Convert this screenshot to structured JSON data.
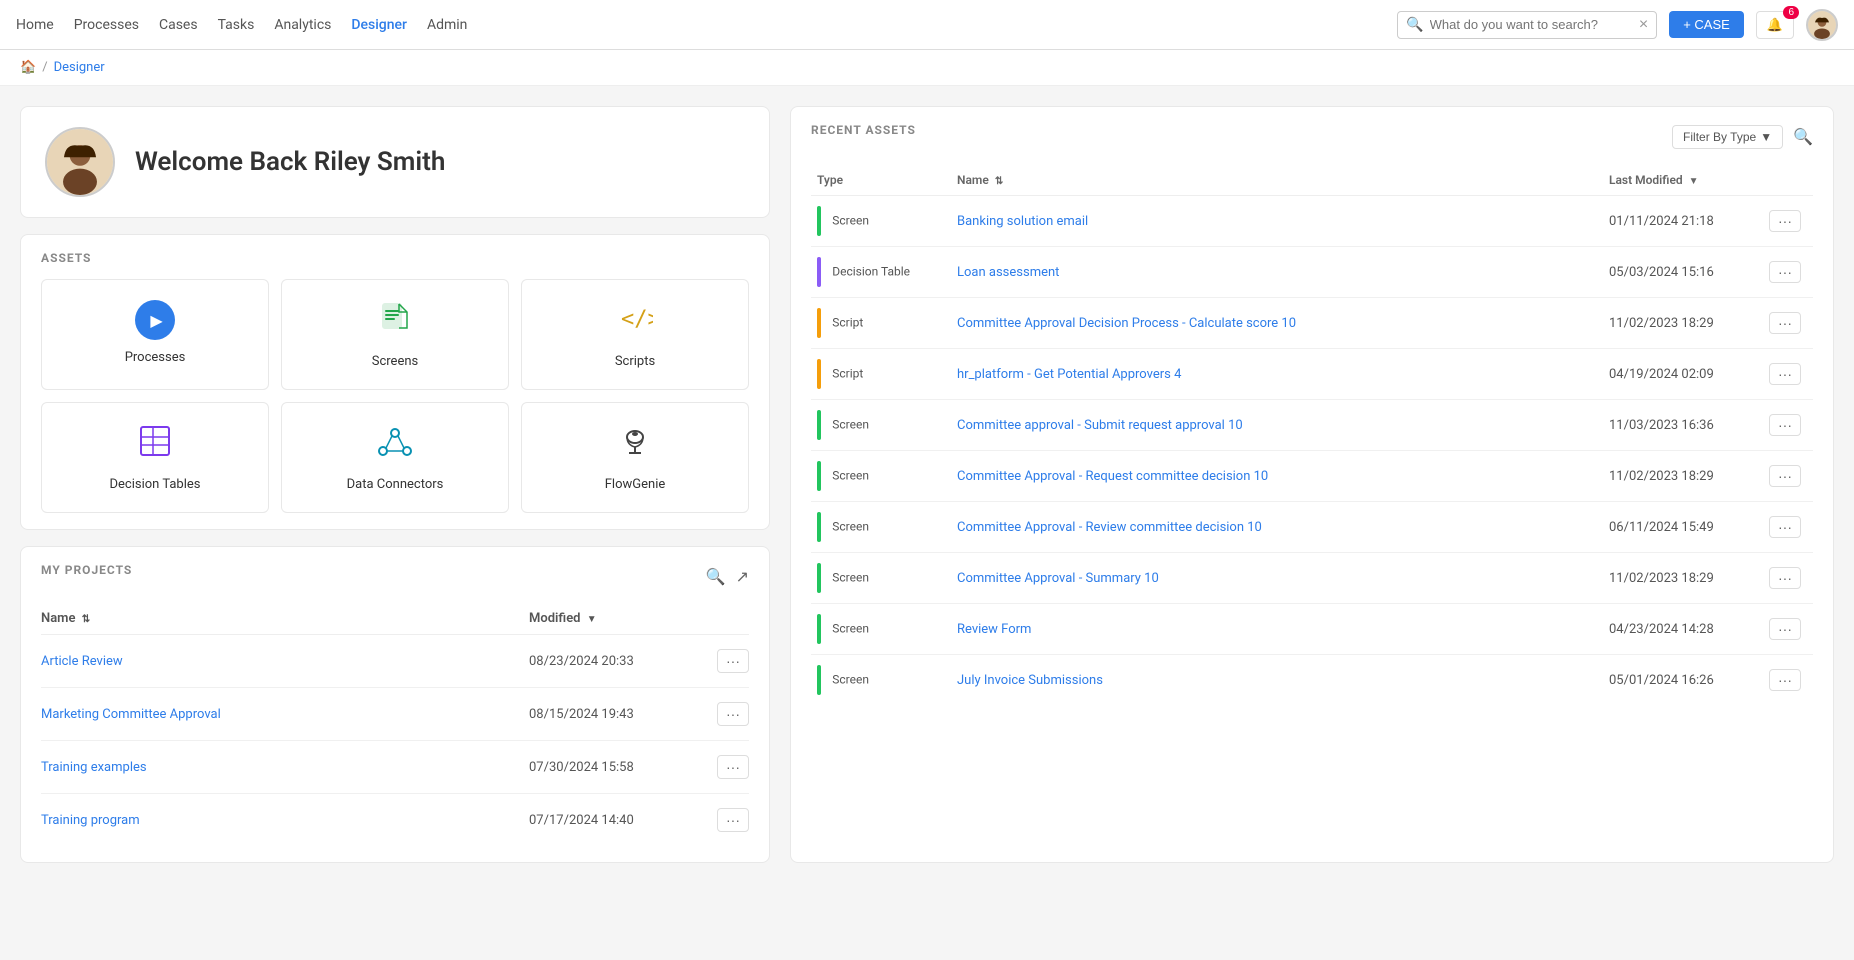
{
  "navbar": {
    "links": [
      {
        "label": "Home",
        "active": false
      },
      {
        "label": "Processes",
        "active": false
      },
      {
        "label": "Cases",
        "active": false
      },
      {
        "label": "Tasks",
        "active": false
      },
      {
        "label": "Analytics",
        "active": false
      },
      {
        "label": "Designer",
        "active": true
      },
      {
        "label": "Admin",
        "active": false
      }
    ],
    "search_placeholder": "What do you want to search?",
    "case_button": "+ CASE",
    "notifications_count": "6",
    "user_name": "Riley Smith"
  },
  "breadcrumb": {
    "home": "🏠",
    "separator": "/",
    "current": "Designer"
  },
  "welcome": {
    "title": "Welcome Back Riley Smith"
  },
  "assets": {
    "section_label": "ASSETS",
    "items": [
      {
        "id": "processes",
        "label": "Processes",
        "icon_type": "play"
      },
      {
        "id": "screens",
        "label": "Screens",
        "icon_type": "doc"
      },
      {
        "id": "scripts",
        "label": "Scripts",
        "icon_type": "code"
      },
      {
        "id": "decision-tables",
        "label": "Decision Tables",
        "icon_type": "table"
      },
      {
        "id": "data-connectors",
        "label": "Data Connectors",
        "icon_type": "share"
      },
      {
        "id": "flowgenie",
        "label": "FlowGenie",
        "icon_type": "lamp"
      }
    ]
  },
  "projects": {
    "section_label": "MY PROJECTS",
    "columns": {
      "name": "Name",
      "modified": "Modified"
    },
    "rows": [
      {
        "name": "Article Review",
        "modified": "08/23/2024 20:33"
      },
      {
        "name": "Marketing Committee Approval",
        "modified": "08/15/2024 19:43"
      },
      {
        "name": "Training examples",
        "modified": "07/30/2024 15:58"
      },
      {
        "name": "Training program",
        "modified": "07/17/2024 14:40"
      }
    ]
  },
  "recent_assets": {
    "section_label": "RECENT ASSETS",
    "filter_label": "Filter By Type",
    "columns": {
      "type": "Type",
      "name": "Name",
      "last_modified": "Last Modified"
    },
    "rows": [
      {
        "type": "Screen",
        "type_color": "screen",
        "name": "Banking solution email",
        "modified": "01/11/2024 21:18"
      },
      {
        "type": "Decision Table",
        "type_color": "decision",
        "name": "Loan assessment",
        "modified": "05/03/2024 15:16"
      },
      {
        "type": "Script",
        "type_color": "script",
        "name": "Committee Approval Decision Process - Calculate score 10",
        "modified": "11/02/2023 18:29"
      },
      {
        "type": "Script",
        "type_color": "script",
        "name": "hr_platform - Get Potential Approvers 4",
        "modified": "04/19/2024 02:09"
      },
      {
        "type": "Screen",
        "type_color": "screen",
        "name": "Committee approval - Submit request approval 10",
        "modified": "11/03/2023 16:36"
      },
      {
        "type": "Screen",
        "type_color": "screen",
        "name": "Committee Approval - Request committee decision 10",
        "modified": "11/02/2023 18:29"
      },
      {
        "type": "Screen",
        "type_color": "screen",
        "name": "Committee Approval - Review committee decision 10",
        "modified": "06/11/2024 15:49"
      },
      {
        "type": "Screen",
        "type_color": "screen",
        "name": "Committee Approval - Summary 10",
        "modified": "11/02/2023 18:29"
      },
      {
        "type": "Screen",
        "type_color": "screen",
        "name": "Review Form",
        "modified": "04/23/2024 14:28"
      },
      {
        "type": "Screen",
        "type_color": "screen",
        "name": "July Invoice Submissions",
        "modified": "05/01/2024 16:26"
      }
    ]
  }
}
